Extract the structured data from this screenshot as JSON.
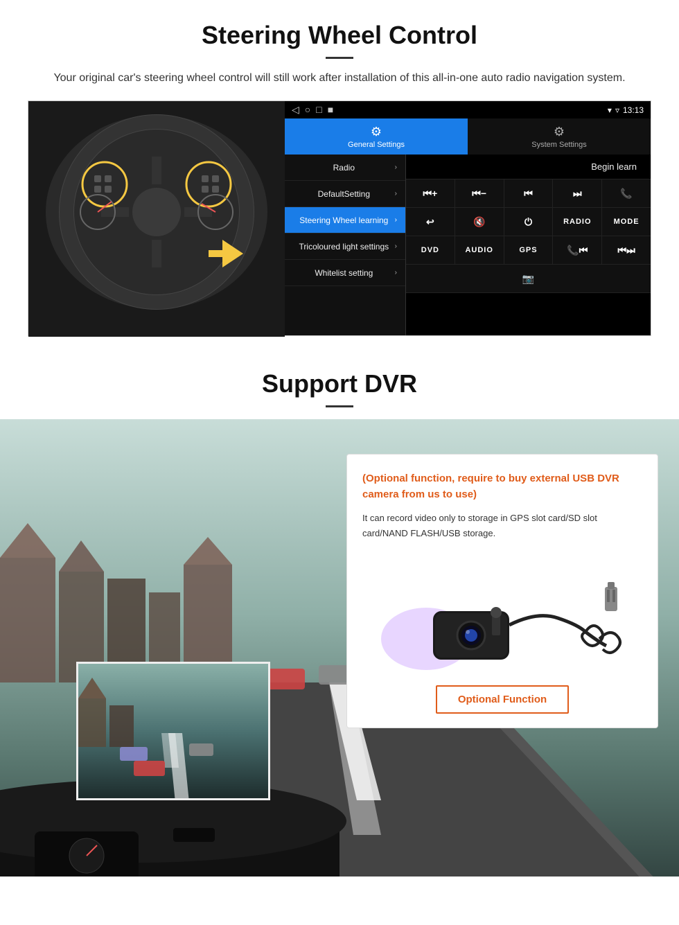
{
  "section1": {
    "title": "Steering Wheel Control",
    "subtitle": "Your original car's steering wheel control will still work after installation of this all-in-one auto radio navigation system.",
    "tabs": {
      "general": {
        "label": "General Settings",
        "icon": "⚙"
      },
      "system": {
        "label": "System Settings",
        "icon": "🔧"
      }
    },
    "menu_items": [
      {
        "label": "Radio",
        "active": false
      },
      {
        "label": "DefaultSetting",
        "active": false
      },
      {
        "label": "Steering Wheel learning",
        "active": true
      },
      {
        "label": "Tricoloured light settings",
        "active": false
      },
      {
        "label": "Whitelist setting",
        "active": false
      }
    ],
    "begin_learn": "Begin learn",
    "status_bar": {
      "time": "13:13",
      "nav_icons": [
        "◁",
        "○",
        "□",
        "■"
      ]
    },
    "control_buttons": {
      "row1": [
        "⏮+",
        "⏮−",
        "⏮",
        "⏭",
        "📞"
      ],
      "row2": [
        "↩",
        "🔇",
        "⏻",
        "RADIO",
        "MODE"
      ],
      "row3": [
        "DVD",
        "AUDIO",
        "GPS",
        "📞⏮",
        "⏮⏭"
      ],
      "row4": [
        "📷"
      ]
    }
  },
  "section2": {
    "title": "Support DVR",
    "optional_note": "(Optional function, require to buy external USB DVR camera from us to use)",
    "description": "It can record video only to storage in GPS slot card/SD slot card/NAND FLASH/USB storage.",
    "optional_button": "Optional Function"
  }
}
